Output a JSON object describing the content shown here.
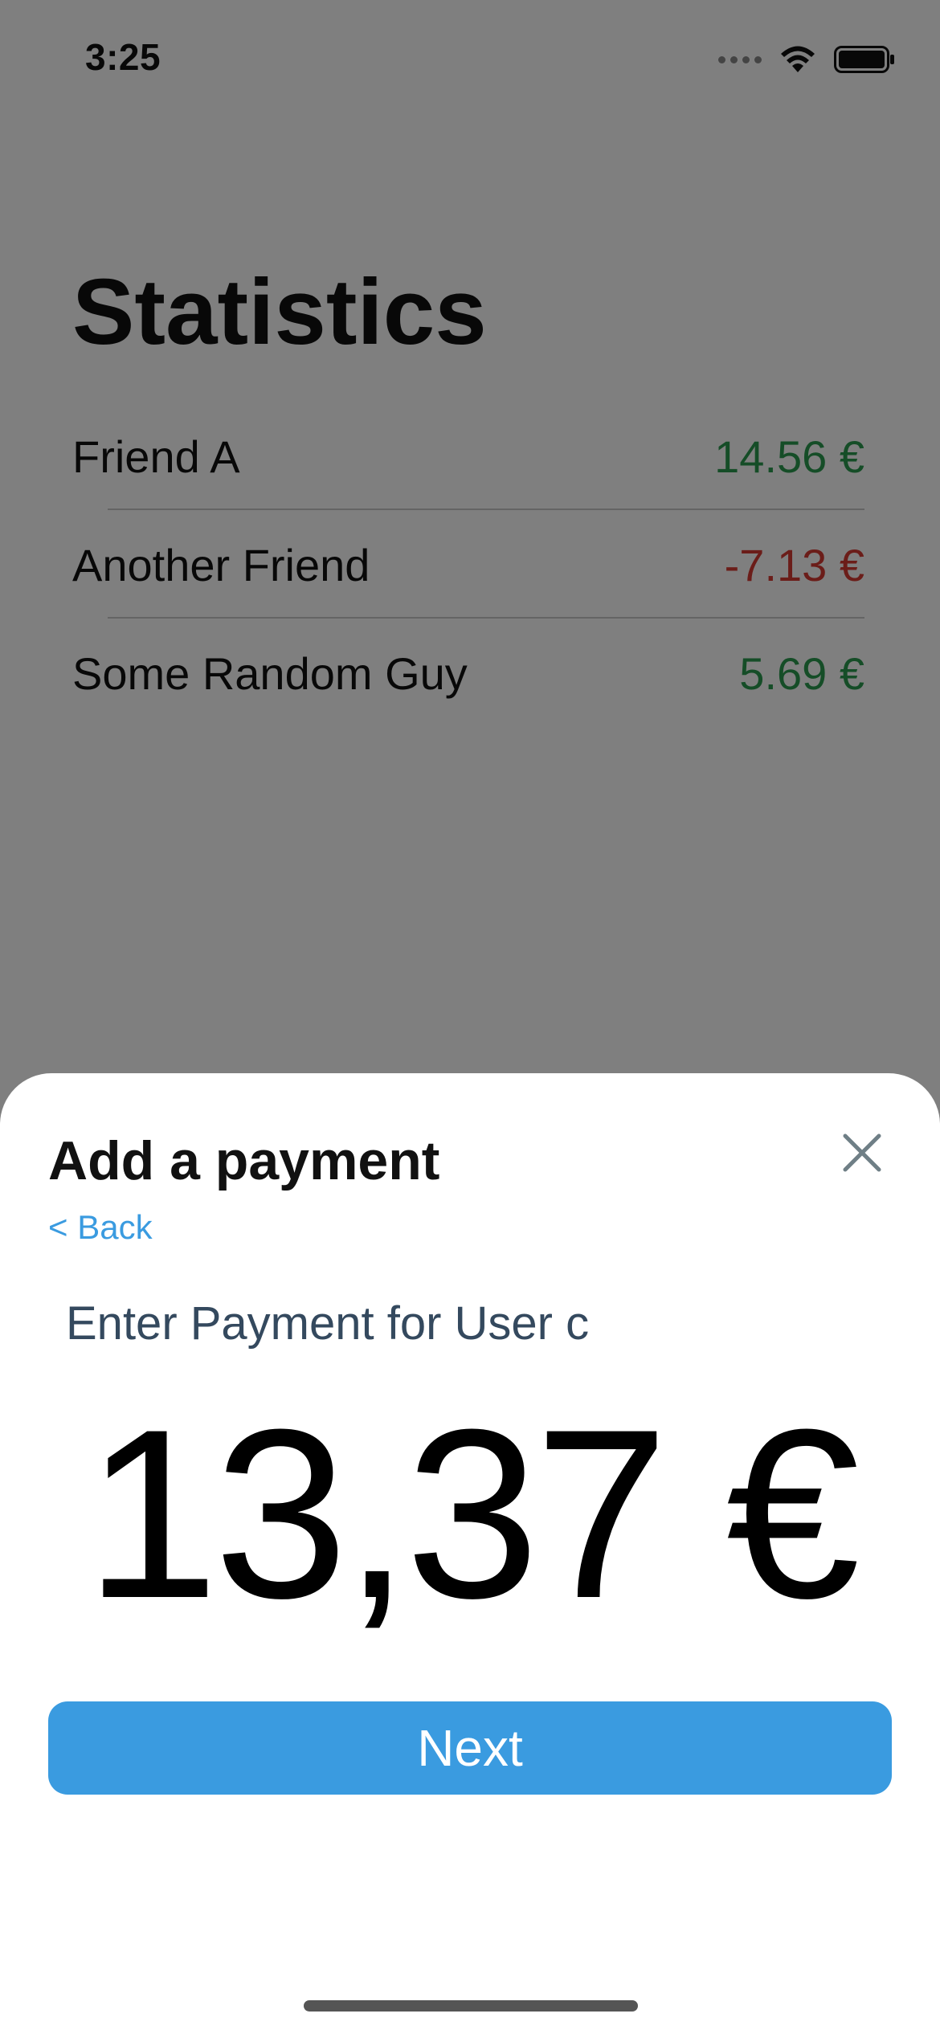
{
  "status_bar": {
    "time": "3:25",
    "icons": [
      "signal-dots-icon",
      "wifi-icon",
      "battery-icon"
    ]
  },
  "background": {
    "title": "Statistics",
    "rows": [
      {
        "name": "Friend A",
        "amount": "14.56 €",
        "sign": "positive"
      },
      {
        "name": "Another Friend",
        "amount": "-7.13 €",
        "sign": "negative"
      },
      {
        "name": "Some Random Guy",
        "amount": "5.69 €",
        "sign": "positive"
      }
    ]
  },
  "sheet": {
    "title": "Add a payment",
    "close_icon": "close-icon",
    "back_label": "< Back",
    "prompt": "Enter Payment for User c",
    "amount": "13,37 €",
    "next_label": "Next"
  },
  "colors": {
    "accent": "#3a9be0",
    "positive": "#2a9a4e",
    "negative": "#d63a33",
    "overlay": "rgba(0,0,0,0.5)"
  }
}
